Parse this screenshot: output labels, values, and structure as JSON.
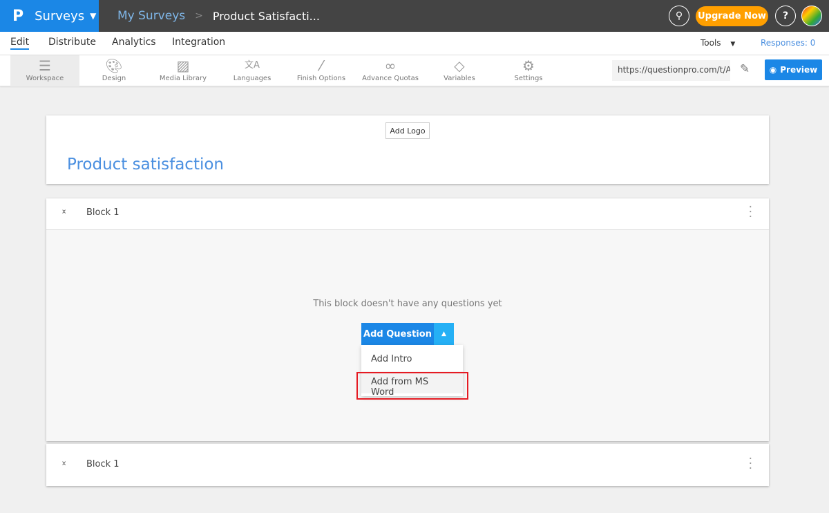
{
  "topbar": {
    "logo": "P",
    "app": "Surveys",
    "breadcrumb": [
      "My Surveys",
      "Product Satisfacti..."
    ],
    "upgrade": "Upgrade Now",
    "help": "?"
  },
  "tabs": [
    "Edit",
    "Distribute",
    "Analytics",
    "Integration"
  ],
  "tools": "Tools",
  "responses": "Responses: 0",
  "toolbar": [
    {
      "label": "Workspace",
      "icon": "list-icon"
    },
    {
      "label": "Design",
      "icon": "palette-icon"
    },
    {
      "label": "Media Library",
      "icon": "image-icon"
    },
    {
      "label": "Languages",
      "icon": "translate-icon"
    },
    {
      "label": "Finish Options",
      "icon": "magic-wand-icon"
    },
    {
      "label": "Advance Quotas",
      "icon": "link-icon"
    },
    {
      "label": "Variables",
      "icon": "tag-icon"
    },
    {
      "label": "Settings",
      "icon": "gear-icon"
    }
  ],
  "url": "https://questionpro.com/t/A",
  "preview": "Preview",
  "survey": {
    "add_logo": "Add Logo",
    "title": "Product satisfaction"
  },
  "blocks": [
    {
      "label": "Block 1",
      "empty": "This block doesn't have any questions yet",
      "add_question": "Add Question",
      "menu": [
        "Add Intro",
        "Add from MS Word"
      ]
    },
    {
      "label": "Block 1"
    }
  ],
  "colors": {
    "primary": "#1b87e6",
    "upgrade": "#ff9f00",
    "highlight": "#e51b23"
  }
}
